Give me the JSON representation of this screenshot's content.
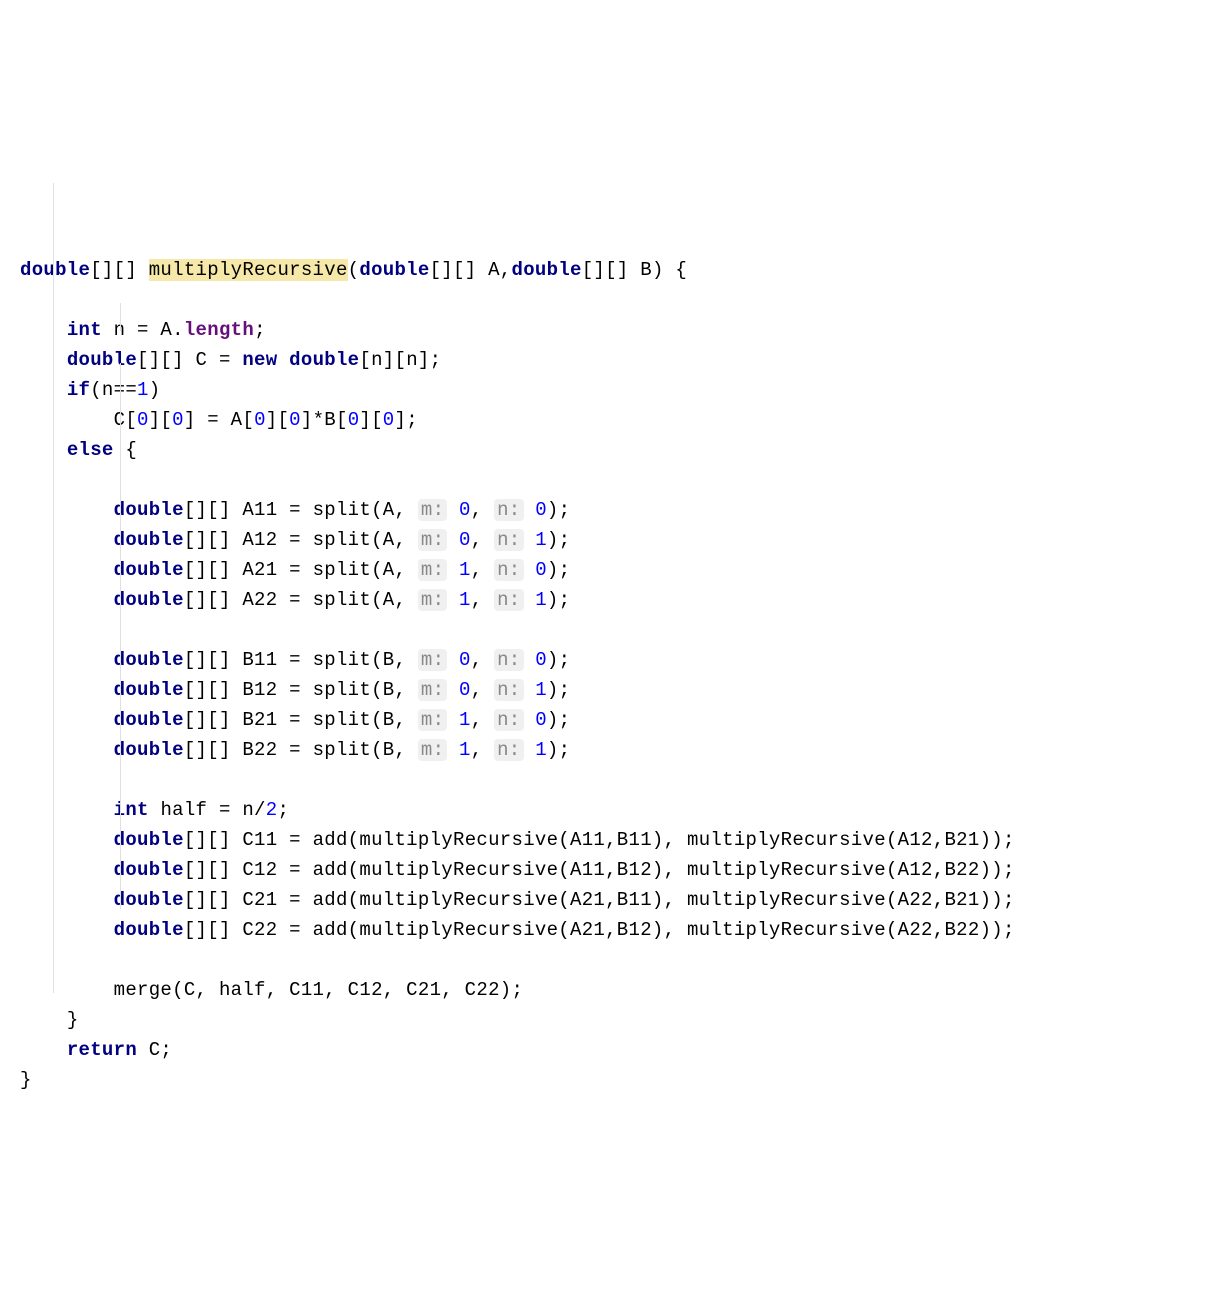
{
  "lines": [
    {
      "type": "line",
      "parts": [
        {
          "cls": "kw",
          "t": "double"
        },
        {
          "t": "[][] "
        },
        {
          "cls": "hl",
          "t": "multiplyRecursive"
        },
        {
          "t": "("
        },
        {
          "cls": "kw",
          "t": "double"
        },
        {
          "t": "[][] A,"
        },
        {
          "cls": "kw",
          "t": "double"
        },
        {
          "t": "[][] B) {"
        }
      ]
    },
    {
      "type": "blank"
    },
    {
      "type": "line",
      "indent": 1,
      "parts": [
        {
          "cls": "kw",
          "t": "int "
        },
        {
          "t": "n = A."
        },
        {
          "cls": "mem",
          "t": "length"
        },
        {
          "t": ";"
        }
      ]
    },
    {
      "type": "line",
      "indent": 1,
      "parts": [
        {
          "cls": "kw",
          "t": "double"
        },
        {
          "t": "[][] C = "
        },
        {
          "cls": "kw",
          "t": "new double"
        },
        {
          "t": "[n][n];"
        }
      ]
    },
    {
      "type": "line",
      "indent": 1,
      "parts": [
        {
          "cls": "kw",
          "t": "if"
        },
        {
          "t": "(n=="
        },
        {
          "cls": "num",
          "t": "1"
        },
        {
          "t": ")"
        }
      ]
    },
    {
      "type": "line",
      "indent": 2,
      "parts": [
        {
          "t": "C["
        },
        {
          "cls": "num",
          "t": "0"
        },
        {
          "t": "]["
        },
        {
          "cls": "num",
          "t": "0"
        },
        {
          "t": "] = A["
        },
        {
          "cls": "num",
          "t": "0"
        },
        {
          "t": "]["
        },
        {
          "cls": "num",
          "t": "0"
        },
        {
          "t": "]*B["
        },
        {
          "cls": "num",
          "t": "0"
        },
        {
          "t": "]["
        },
        {
          "cls": "num",
          "t": "0"
        },
        {
          "t": "];"
        }
      ]
    },
    {
      "type": "line",
      "indent": 1,
      "parts": [
        {
          "cls": "kw",
          "t": "else "
        },
        {
          "t": "{"
        }
      ]
    },
    {
      "type": "blank"
    },
    {
      "type": "line",
      "indent": 2,
      "parts": [
        {
          "cls": "kw",
          "t": "double"
        },
        {
          "t": "[][] A11 = split(A, "
        },
        {
          "cls": "hint",
          "t": "m:"
        },
        {
          "t": " "
        },
        {
          "cls": "num",
          "t": "0"
        },
        {
          "t": ", "
        },
        {
          "cls": "hint",
          "t": "n:"
        },
        {
          "t": " "
        },
        {
          "cls": "num",
          "t": "0"
        },
        {
          "t": ");"
        }
      ]
    },
    {
      "type": "line",
      "indent": 2,
      "parts": [
        {
          "cls": "kw",
          "t": "double"
        },
        {
          "t": "[][] A12 = split(A, "
        },
        {
          "cls": "hint",
          "t": "m:"
        },
        {
          "t": " "
        },
        {
          "cls": "num",
          "t": "0"
        },
        {
          "t": ", "
        },
        {
          "cls": "hint",
          "t": "n:"
        },
        {
          "t": " "
        },
        {
          "cls": "num",
          "t": "1"
        },
        {
          "t": ");"
        }
      ]
    },
    {
      "type": "line",
      "indent": 2,
      "parts": [
        {
          "cls": "kw",
          "t": "double"
        },
        {
          "t": "[][] A21 = split(A, "
        },
        {
          "cls": "hint",
          "t": "m:"
        },
        {
          "t": " "
        },
        {
          "cls": "num",
          "t": "1"
        },
        {
          "t": ", "
        },
        {
          "cls": "hint",
          "t": "n:"
        },
        {
          "t": " "
        },
        {
          "cls": "num",
          "t": "0"
        },
        {
          "t": ");"
        }
      ]
    },
    {
      "type": "line",
      "indent": 2,
      "parts": [
        {
          "cls": "kw",
          "t": "double"
        },
        {
          "t": "[][] A22 = split(A, "
        },
        {
          "cls": "hint",
          "t": "m:"
        },
        {
          "t": " "
        },
        {
          "cls": "num",
          "t": "1"
        },
        {
          "t": ", "
        },
        {
          "cls": "hint",
          "t": "n:"
        },
        {
          "t": " "
        },
        {
          "cls": "num",
          "t": "1"
        },
        {
          "t": ");"
        }
      ]
    },
    {
      "type": "blank"
    },
    {
      "type": "line",
      "indent": 2,
      "parts": [
        {
          "cls": "kw",
          "t": "double"
        },
        {
          "t": "[][] B11 = split(B, "
        },
        {
          "cls": "hint",
          "t": "m:"
        },
        {
          "t": " "
        },
        {
          "cls": "num",
          "t": "0"
        },
        {
          "t": ", "
        },
        {
          "cls": "hint",
          "t": "n:"
        },
        {
          "t": " "
        },
        {
          "cls": "num",
          "t": "0"
        },
        {
          "t": ");"
        }
      ]
    },
    {
      "type": "line",
      "indent": 2,
      "parts": [
        {
          "cls": "kw",
          "t": "double"
        },
        {
          "t": "[][] B12 = split(B, "
        },
        {
          "cls": "hint",
          "t": "m:"
        },
        {
          "t": " "
        },
        {
          "cls": "num",
          "t": "0"
        },
        {
          "t": ", "
        },
        {
          "cls": "hint",
          "t": "n:"
        },
        {
          "t": " "
        },
        {
          "cls": "num",
          "t": "1"
        },
        {
          "t": ");"
        }
      ]
    },
    {
      "type": "line",
      "indent": 2,
      "parts": [
        {
          "cls": "kw",
          "t": "double"
        },
        {
          "t": "[][] B21 = split(B, "
        },
        {
          "cls": "hint",
          "t": "m:"
        },
        {
          "t": " "
        },
        {
          "cls": "num",
          "t": "1"
        },
        {
          "t": ", "
        },
        {
          "cls": "hint",
          "t": "n:"
        },
        {
          "t": " "
        },
        {
          "cls": "num",
          "t": "0"
        },
        {
          "t": ");"
        }
      ]
    },
    {
      "type": "line",
      "indent": 2,
      "parts": [
        {
          "cls": "kw",
          "t": "double"
        },
        {
          "t": "[][] B22 = split(B, "
        },
        {
          "cls": "hint",
          "t": "m:"
        },
        {
          "t": " "
        },
        {
          "cls": "num",
          "t": "1"
        },
        {
          "t": ", "
        },
        {
          "cls": "hint",
          "t": "n:"
        },
        {
          "t": " "
        },
        {
          "cls": "num",
          "t": "1"
        },
        {
          "t": ");"
        }
      ]
    },
    {
      "type": "blank"
    },
    {
      "type": "line",
      "indent": 2,
      "parts": [
        {
          "cls": "kw",
          "t": "int "
        },
        {
          "t": "half = n/"
        },
        {
          "cls": "num",
          "t": "2"
        },
        {
          "t": ";"
        }
      ]
    },
    {
      "type": "line",
      "indent": 2,
      "parts": [
        {
          "cls": "kw",
          "t": "double"
        },
        {
          "t": "[][] C11 = add(multiplyRecursive(A11,B11), multiplyRecursive(A12,B21));"
        }
      ]
    },
    {
      "type": "line",
      "indent": 2,
      "parts": [
        {
          "cls": "kw",
          "t": "double"
        },
        {
          "t": "[][] C12 = add(multiplyRecursive(A11,B12), multiplyRecursive(A12,B22));"
        }
      ]
    },
    {
      "type": "line",
      "indent": 2,
      "parts": [
        {
          "cls": "kw",
          "t": "double"
        },
        {
          "t": "[][] C21 = add(multiplyRecursive(A21,B11), multiplyRecursive(A22,B21));"
        }
      ]
    },
    {
      "type": "line",
      "indent": 2,
      "parts": [
        {
          "cls": "kw",
          "t": "double"
        },
        {
          "t": "[][] C22 = add(multiplyRecursive(A21,B12), multiplyRecursive(A22,B22));"
        }
      ]
    },
    {
      "type": "blank"
    },
    {
      "type": "line",
      "indent": 2,
      "parts": [
        {
          "t": "merge(C, half, C11, C12, C21, C22);"
        }
      ]
    },
    {
      "type": "line",
      "indent": 1,
      "parts": [
        {
          "t": "}"
        }
      ]
    },
    {
      "type": "line",
      "indent": 1,
      "parts": [
        {
          "cls": "kw",
          "t": "return "
        },
        {
          "t": "C;"
        }
      ]
    },
    {
      "type": "line",
      "parts": [
        {
          "t": "}"
        }
      ]
    }
  ],
  "indentUnit": "    "
}
